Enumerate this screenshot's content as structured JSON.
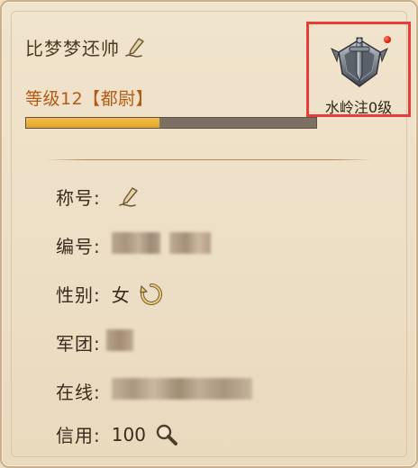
{
  "player": {
    "name": "比梦梦还帅",
    "level_text": "等级12【都尉】",
    "level_progress": 0.46
  },
  "badge": {
    "label": "水岭注0级",
    "has_notification": true,
    "icon": "sword-emblem-icon"
  },
  "info": {
    "title_label": "称号:",
    "id_label": "编号:",
    "gender_label": "性别:",
    "gender_value": "女",
    "legion_label": "军团:",
    "online_label": "在线:",
    "credit_label": "信用:",
    "credit_value": "100"
  },
  "colors": {
    "level_text": "#b45a14",
    "progress_fill": "#e3a22a",
    "progress_track": "#7c7065",
    "highlight_box": "#e53c3c"
  }
}
